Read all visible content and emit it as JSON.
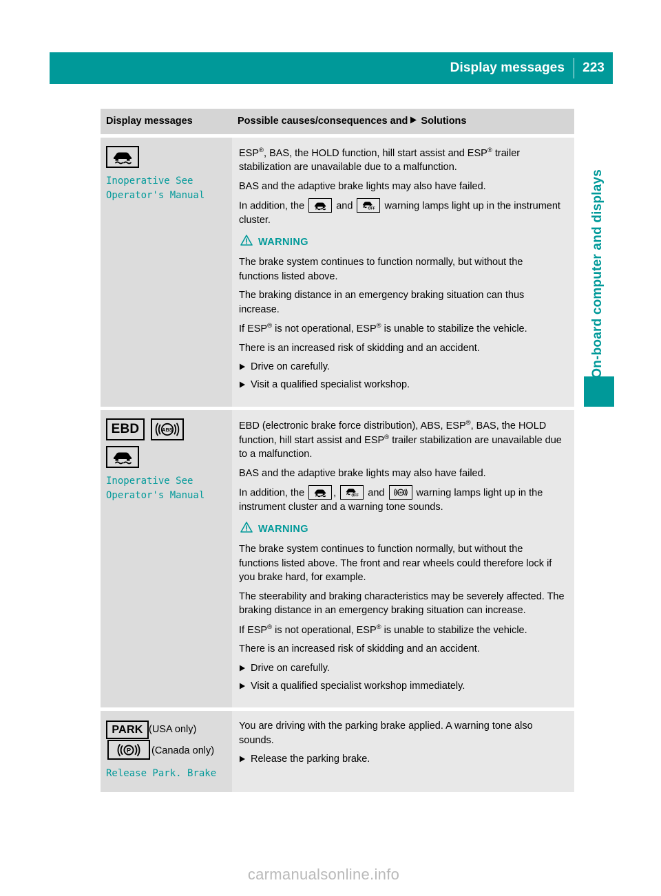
{
  "header": {
    "title": "Display messages",
    "page_number": "223"
  },
  "side_tab": {
    "label": "On-board computer and displays"
  },
  "table": {
    "headers": {
      "left": "Display messages",
      "right_before_arrow": "Possible causes/consequences and",
      "right_after_arrow": "Solutions"
    },
    "rows": [
      {
        "left": {
          "icons": [
            "esp-skid-car-icon"
          ],
          "message": "Inoperative See\nOperator's Manual"
        },
        "right": {
          "paragraphs": [
            "ESP®, BAS, the HOLD function, hill start assist and ESP® trailer stabilization are unavailable due to a malfunction.",
            "BAS and the adaptive brake lights may also have failed.",
            "In addition, the [esp-skid-car-icon] and [esp-off-icon] warning lamps light up in the instrument cluster."
          ],
          "warning_label": "WARNING",
          "warning_paragraphs": [
            "The brake system continues to function normally, but without the functions listed above.",
            "The braking distance in an emergency braking situation can thus increase.",
            "If ESP® is not operational, ESP® is unable to stabilize the vehicle.",
            "There is an increased risk of skidding and an accident."
          ],
          "bullets": [
            "Drive on carefully.",
            "Visit a qualified specialist workshop."
          ]
        }
      },
      {
        "left": {
          "icons": [
            "ebd-icon",
            "abs-icon",
            "esp-skid-car-icon"
          ],
          "ebd_label": "EBD",
          "message": "Inoperative See\nOperator's Manual"
        },
        "right": {
          "paragraphs": [
            "EBD (electronic brake force distribution), ABS, ESP®, BAS, the HOLD function, hill start assist and ESP® trailer stabilization are unavailable due to a malfunction.",
            "BAS and the adaptive brake lights may also have failed.",
            "In addition, the [esp-skid-car-icon], [esp-off-icon] and [abs-icon] warning lamps light up in the instrument cluster and a warning tone sounds."
          ],
          "warning_label": "WARNING",
          "warning_paragraphs": [
            "The brake system continues to function normally, but without the functions listed above. The front and rear wheels could therefore lock if you brake hard, for example.",
            "The steerability and braking characteristics may be severely affected. The braking distance in an emergency braking situation can increase.",
            "If ESP® is not operational, ESP® is unable to stabilize the vehicle.",
            "There is an increased risk of skidding and an accident."
          ],
          "bullets": [
            "Drive on carefully.",
            "Visit a qualified specialist workshop immediately."
          ]
        }
      },
      {
        "left": {
          "park_label": "PARK",
          "usa_note": "(USA",
          "only_1": "only)",
          "canada_note": "(Canada",
          "only_2": "only)",
          "message": "Release Park. Brake"
        },
        "right": {
          "paragraphs": [
            "You are driving with the parking brake applied. A warning tone also sounds."
          ],
          "bullets": [
            "Release the parking brake."
          ]
        }
      }
    ]
  },
  "watermark": "carmanualsonline.info",
  "colors": {
    "accent_teal": "#009999",
    "header_cell_bg": "#d5d5d5",
    "left_cell_bg": "#dcdcdc",
    "right_cell_bg": "#e8e8e8",
    "page_bg": "#ffffff"
  },
  "text_fragments": {
    "esp": "ESP",
    "reg": "®",
    "in_addition": "In addition, the",
    "and": "and",
    "comma": ",",
    "warning_lamps_1": "warning lamps light up in the instrument cluster.",
    "warning_lamps_2": "warning lamps light up in the instrument cluster and a warning tone sounds.",
    "r1p1_a": ", BAS, the HOLD function, hill start assist and ",
    "r1p1_b": " trailer stabilization are unavailable due to a malfunction.",
    "r1p2": "BAS and the adaptive brake lights may also have failed.",
    "r1w1": "The brake system continues to function normally, but without the functions listed above.",
    "r1w2": "The braking distance in an emergency braking situation can thus increase.",
    "ifesp_a": "If ",
    "ifesp_b": " is not operational, ",
    "ifesp_c": " is unable to stabilize the vehicle.",
    "risk": "There is an increased risk of skidding and an accident.",
    "r2p1_a": "EBD (electronic brake force distribution), ABS, ",
    "r2p1_b": ", BAS, the HOLD function, hill start assist and ",
    "r2p1_c": " trailer stabilization are unavailable due to a malfunction.",
    "r2w1": "The brake system continues to function normally, but without the functions listed above. The front and rear wheels could therefore lock if you brake hard, for example.",
    "r2w2": "The steerability and braking characteristics may be severely affected. The braking distance in an emergency braking situation can increase.",
    "r3p1": "You are driving with the parking brake applied. A warning tone also sounds."
  }
}
